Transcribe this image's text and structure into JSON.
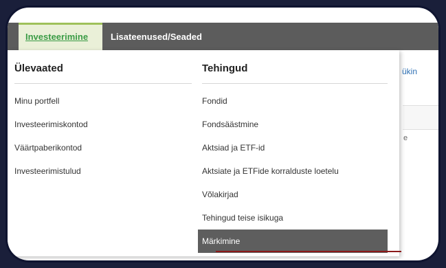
{
  "tabs": [
    {
      "label": "Investeerimine"
    },
    {
      "label": "Lisateenused/Seaded"
    }
  ],
  "overviews": {
    "title": "Ülevaated",
    "items": [
      {
        "label": "Minu portfell"
      },
      {
        "label": "Investeerimiskontod"
      },
      {
        "label": "Väärtpaberikontod"
      },
      {
        "label": "Investeerimistulud"
      }
    ]
  },
  "transactions": {
    "title": "Tehingud",
    "items": [
      {
        "label": "Fondid"
      },
      {
        "label": "Fondsäästmine"
      },
      {
        "label": "Aktsiad ja ETF-id"
      },
      {
        "label": "Aktsiate ja ETFide korralduste loetelu"
      },
      {
        "label": "Võlakirjad"
      },
      {
        "label": "Tehingud teise isikuga"
      },
      {
        "label": "Märkimine"
      }
    ]
  },
  "background": {
    "link_fragment": "ükin",
    "char_fragment": "e"
  },
  "colors": {
    "topbar": "#5c5c5c",
    "active_tab_text": "#3a9b45",
    "highlight": "#5e5e5e",
    "frame": "#1a1f3a"
  }
}
